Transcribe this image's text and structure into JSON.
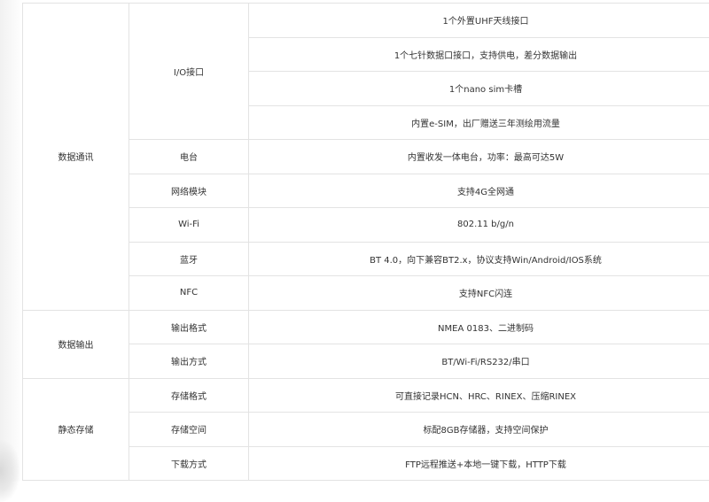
{
  "groups": [
    {
      "category": "数据通讯",
      "items": [
        {
          "name": "I/O接口",
          "values": [
            "1个外置UHF天线接口",
            "1个七针数据口接口，支持供电，差分数据输出",
            "1个nano sim卡槽",
            "内置e-SIM，出厂赠送三年测绘用流量"
          ]
        },
        {
          "name": "电台",
          "values": [
            "内置收发一体电台，功率：最高可达5W"
          ]
        },
        {
          "name": "网络模块",
          "values": [
            "支持4G全网通"
          ]
        },
        {
          "name": "Wi-Fi",
          "values": [
            "802.11 b/g/n"
          ]
        },
        {
          "name": "蓝牙",
          "values": [
            "BT 4.0，向下兼容BT2.x，协议支持Win/Android/IOS系统"
          ]
        },
        {
          "name": "NFC",
          "values": [
            "支持NFC闪连"
          ]
        }
      ]
    },
    {
      "category": "数据输出",
      "items": [
        {
          "name": "输出格式",
          "values": [
            "NMEA 0183、二进制码"
          ]
        },
        {
          "name": "输出方式",
          "values": [
            "BT/Wi-Fi/RS232/串口"
          ]
        }
      ]
    },
    {
      "category": "静态存储",
      "items": [
        {
          "name": "存储格式",
          "values": [
            "可直接记录HCN、HRC、RINEX、压缩RINEX"
          ]
        },
        {
          "name": "存储空间",
          "values": [
            "标配8GB存储器，支持空间保护"
          ]
        },
        {
          "name": "下载方式",
          "values": [
            "FTP远程推送+本地一键下载，HTTP下载"
          ]
        }
      ]
    }
  ]
}
